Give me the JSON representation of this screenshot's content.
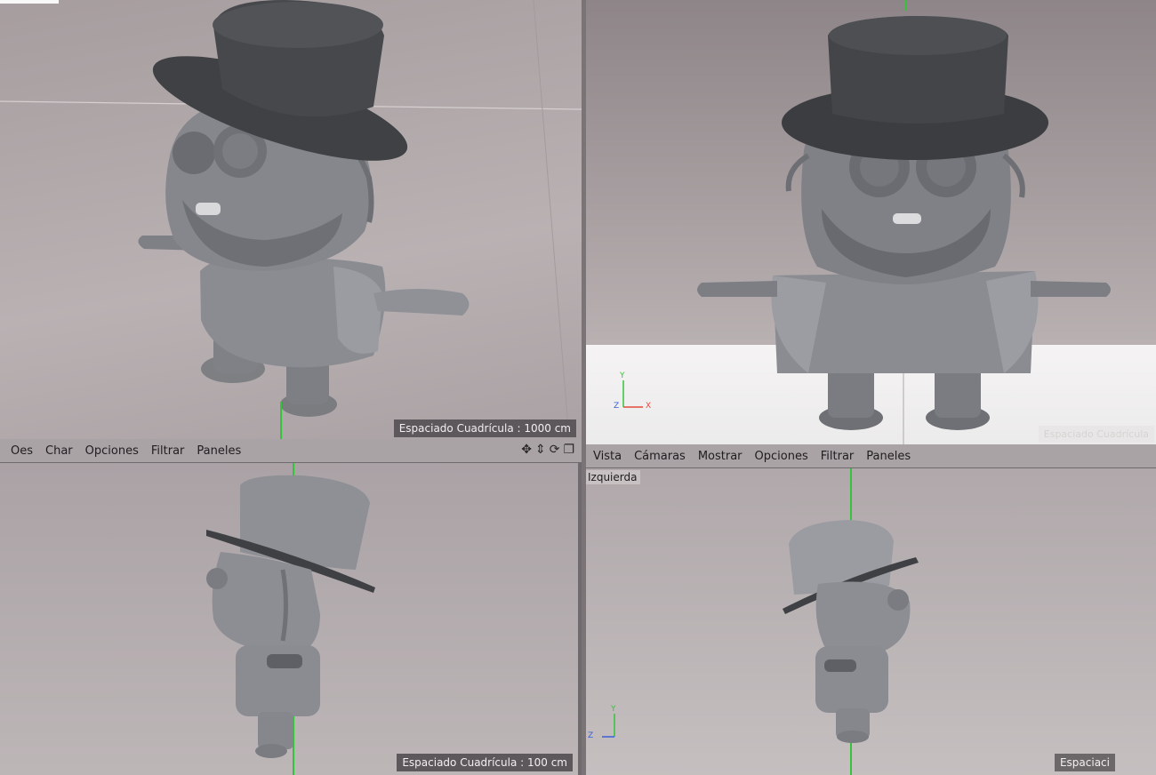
{
  "menus": {
    "left": [
      "Oes",
      "Char",
      "Opciones",
      "Filtrar",
      "Paneles"
    ],
    "right": [
      "Vista",
      "Cámaras",
      "Mostrar",
      "Opciones",
      "Filtrar",
      "Paneles"
    ]
  },
  "viewports": {
    "top_left": {
      "grid_label": "Espaciado Cuadrícula : 1000 cm"
    },
    "top_right": {
      "grid_label": "Espaciado Cuadrícula"
    },
    "bottom_left": {
      "grid_label": "Espaciado Cuadrícula : 100 cm"
    },
    "bottom_right": {
      "view_name": "Izquierda",
      "grid_label": "Espaciaci"
    }
  },
  "axes": {
    "x": "X",
    "y": "Y",
    "z": "Z"
  },
  "colors": {
    "axis_green": "#37c23c",
    "axis_red": "#e24a3c",
    "axis_blue": "#3a5fd8"
  },
  "icons": [
    "move-icon",
    "arrows-icon",
    "rotate-icon",
    "maximize-icon"
  ]
}
